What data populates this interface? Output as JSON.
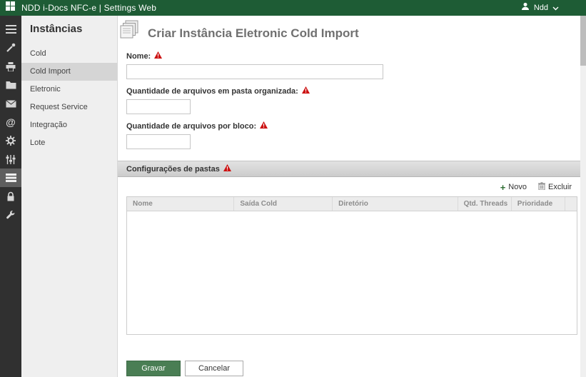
{
  "topbar": {
    "title": "NDD i-Docs NFC-e | Settings Web",
    "user": "Ndd"
  },
  "icons": {
    "plus": "+",
    "at": "@"
  },
  "sidebar": {
    "title": "Instâncias",
    "selected": "Cold Import",
    "items": [
      {
        "label": "Cold"
      },
      {
        "label": "Cold Import"
      },
      {
        "label": "Eletronic"
      },
      {
        "label": "Request Service"
      },
      {
        "label": "Integração"
      },
      {
        "label": "Lote"
      }
    ]
  },
  "main": {
    "title": "Criar Instância Eletronic Cold Import",
    "fields": {
      "nome_label": "Nome:",
      "pasta_label": "Quantidade de arquivos em pasta organizada:",
      "bloco_label": "Quantidade de arquivos por bloco:",
      "nome_value": "",
      "pasta_value": "",
      "bloco_value": ""
    },
    "section": {
      "title": "Configurações de pastas",
      "toolbar": {
        "novo": "Novo",
        "excluir": "Excluir"
      },
      "table_headers": [
        "Nome",
        "Saída Cold",
        "Diretório",
        "Qtd. Threads",
        "Prioridade"
      ]
    },
    "buttons": {
      "save": "Gravar",
      "cancel": "Cancelar"
    }
  },
  "colors": {
    "topbar_green": "#1e5c35",
    "save_green": "#4a7e54",
    "warning_red": "#cc1111"
  }
}
